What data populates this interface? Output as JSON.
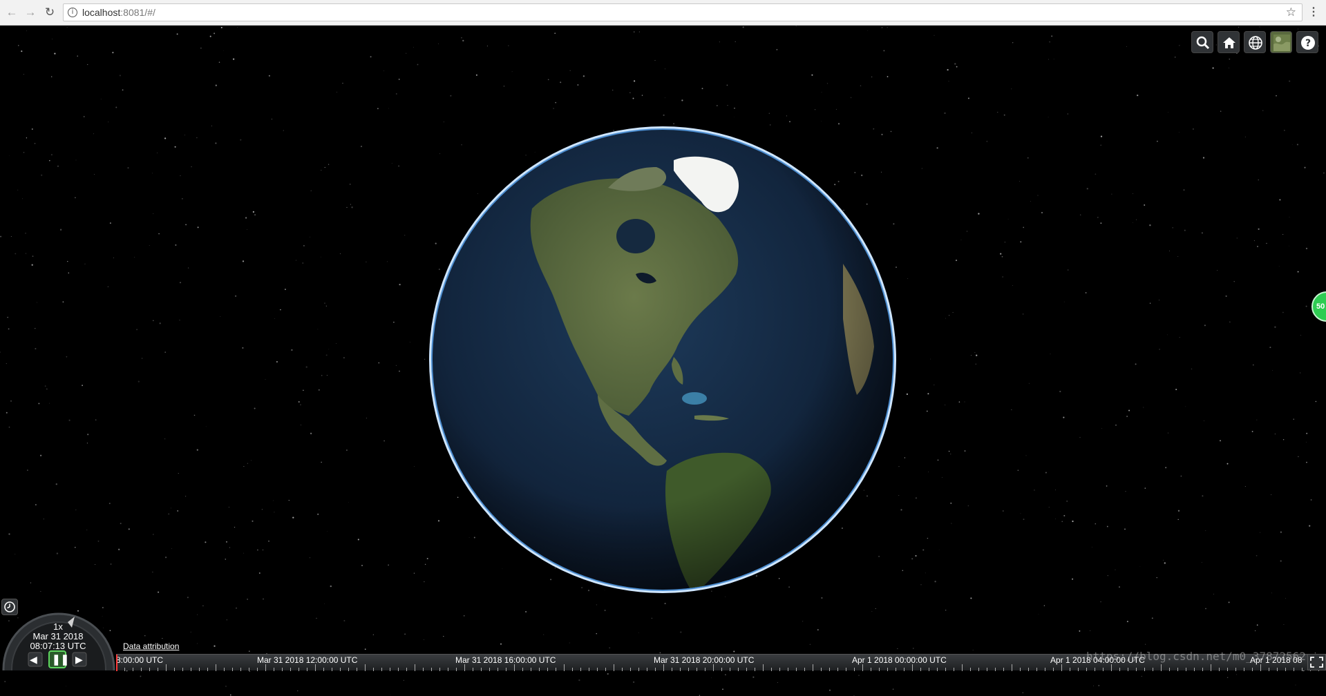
{
  "browser": {
    "url_host": "localhost",
    "url_rest": ":8081/#/"
  },
  "viewer": {
    "side_badge": "50"
  },
  "toolbar": {
    "icons": [
      "search-icon",
      "home-icon",
      "globe-icon",
      "imagery-icon",
      "help-icon"
    ]
  },
  "animation": {
    "speed": "1x",
    "date": "Mar 31 2018",
    "time": "08:07:13 UTC"
  },
  "credits": {
    "data_attribution": "Data attribution"
  },
  "timeline": {
    "labels": [
      "8:00:00 UTC",
      "Mar 31 2018 12:00:00 UTC",
      "Mar 31 2018 16:00:00 UTC",
      "Mar 31 2018 20:00:00 UTC",
      "Apr 1 2018 00:00:00 UTC",
      "Apr 1 2018 04:00:00 UTC",
      "Apr 1 2018 08"
    ]
  },
  "watermark": "https://blog.csdn.net/m0_37872562"
}
